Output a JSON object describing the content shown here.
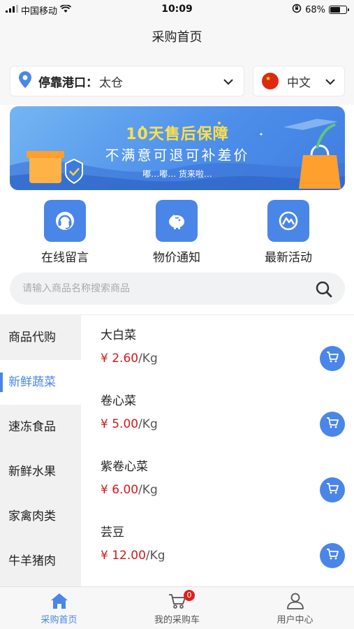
{
  "status_bar": {
    "carrier": "中国移动",
    "time": "10:09",
    "battery": "68%",
    "battery_level": 0.68
  },
  "header": {
    "title": "采购首页"
  },
  "port_selector": {
    "label": "停靠港口：",
    "value": "太仓"
  },
  "language_selector": {
    "value": "中文"
  },
  "banner": {
    "title": "10天售后保障",
    "subtitle": "不满意可退可补差价",
    "tagline": "嘟…嘟… 货来啦…"
  },
  "quick_actions": [
    {
      "label": "在线留言",
      "icon": "headset-icon"
    },
    {
      "label": "物价通知",
      "icon": "piggy-bank-icon"
    },
    {
      "label": "最新活动",
      "icon": "activity-icon"
    }
  ],
  "search": {
    "placeholder": "请输入商品名称搜索商品"
  },
  "categories": [
    {
      "label": "商品代购",
      "active": false
    },
    {
      "label": "新鲜蔬菜",
      "active": true
    },
    {
      "label": "速冻食品",
      "active": false
    },
    {
      "label": "新鲜水果",
      "active": false
    },
    {
      "label": "家禽肉类",
      "active": false
    },
    {
      "label": "牛羊猪肉",
      "active": false
    }
  ],
  "products": [
    {
      "name": "大白菜",
      "price": "¥ 2.60",
      "unit": "/Kg"
    },
    {
      "name": "卷心菜",
      "price": "¥ 5.00",
      "unit": "/Kg"
    },
    {
      "name": "紫卷心菜",
      "price": "¥ 6.00",
      "unit": "/Kg"
    },
    {
      "name": "芸豆",
      "price": "¥ 12.00",
      "unit": "/Kg"
    }
  ],
  "tabs": [
    {
      "label": "采购首页",
      "icon": "home-icon",
      "active": true
    },
    {
      "label": "我的采购车",
      "icon": "cart-icon",
      "badge": "0",
      "active": false
    },
    {
      "label": "用户中心",
      "icon": "user-icon",
      "active": false
    }
  ],
  "colors": {
    "accent": "#4a86e8",
    "price": "#d0191b",
    "banner_title": "#ffe04a"
  }
}
